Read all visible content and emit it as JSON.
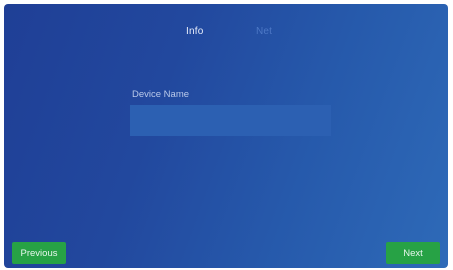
{
  "tabs": [
    {
      "label": "Info",
      "active": true
    },
    {
      "label": "Net",
      "active": false
    }
  ],
  "form": {
    "device_name_label": "Device Name",
    "device_name_value": "",
    "device_name_placeholder": ""
  },
  "buttons": {
    "previous_label": "Previous",
    "next_label": "Next"
  },
  "colors": {
    "background_start": "#1f3f96",
    "background_end": "#2e6ab8",
    "button_green": "#27a245",
    "input_background": "#2c60b2",
    "inactive_tab": "#4d78c6"
  }
}
